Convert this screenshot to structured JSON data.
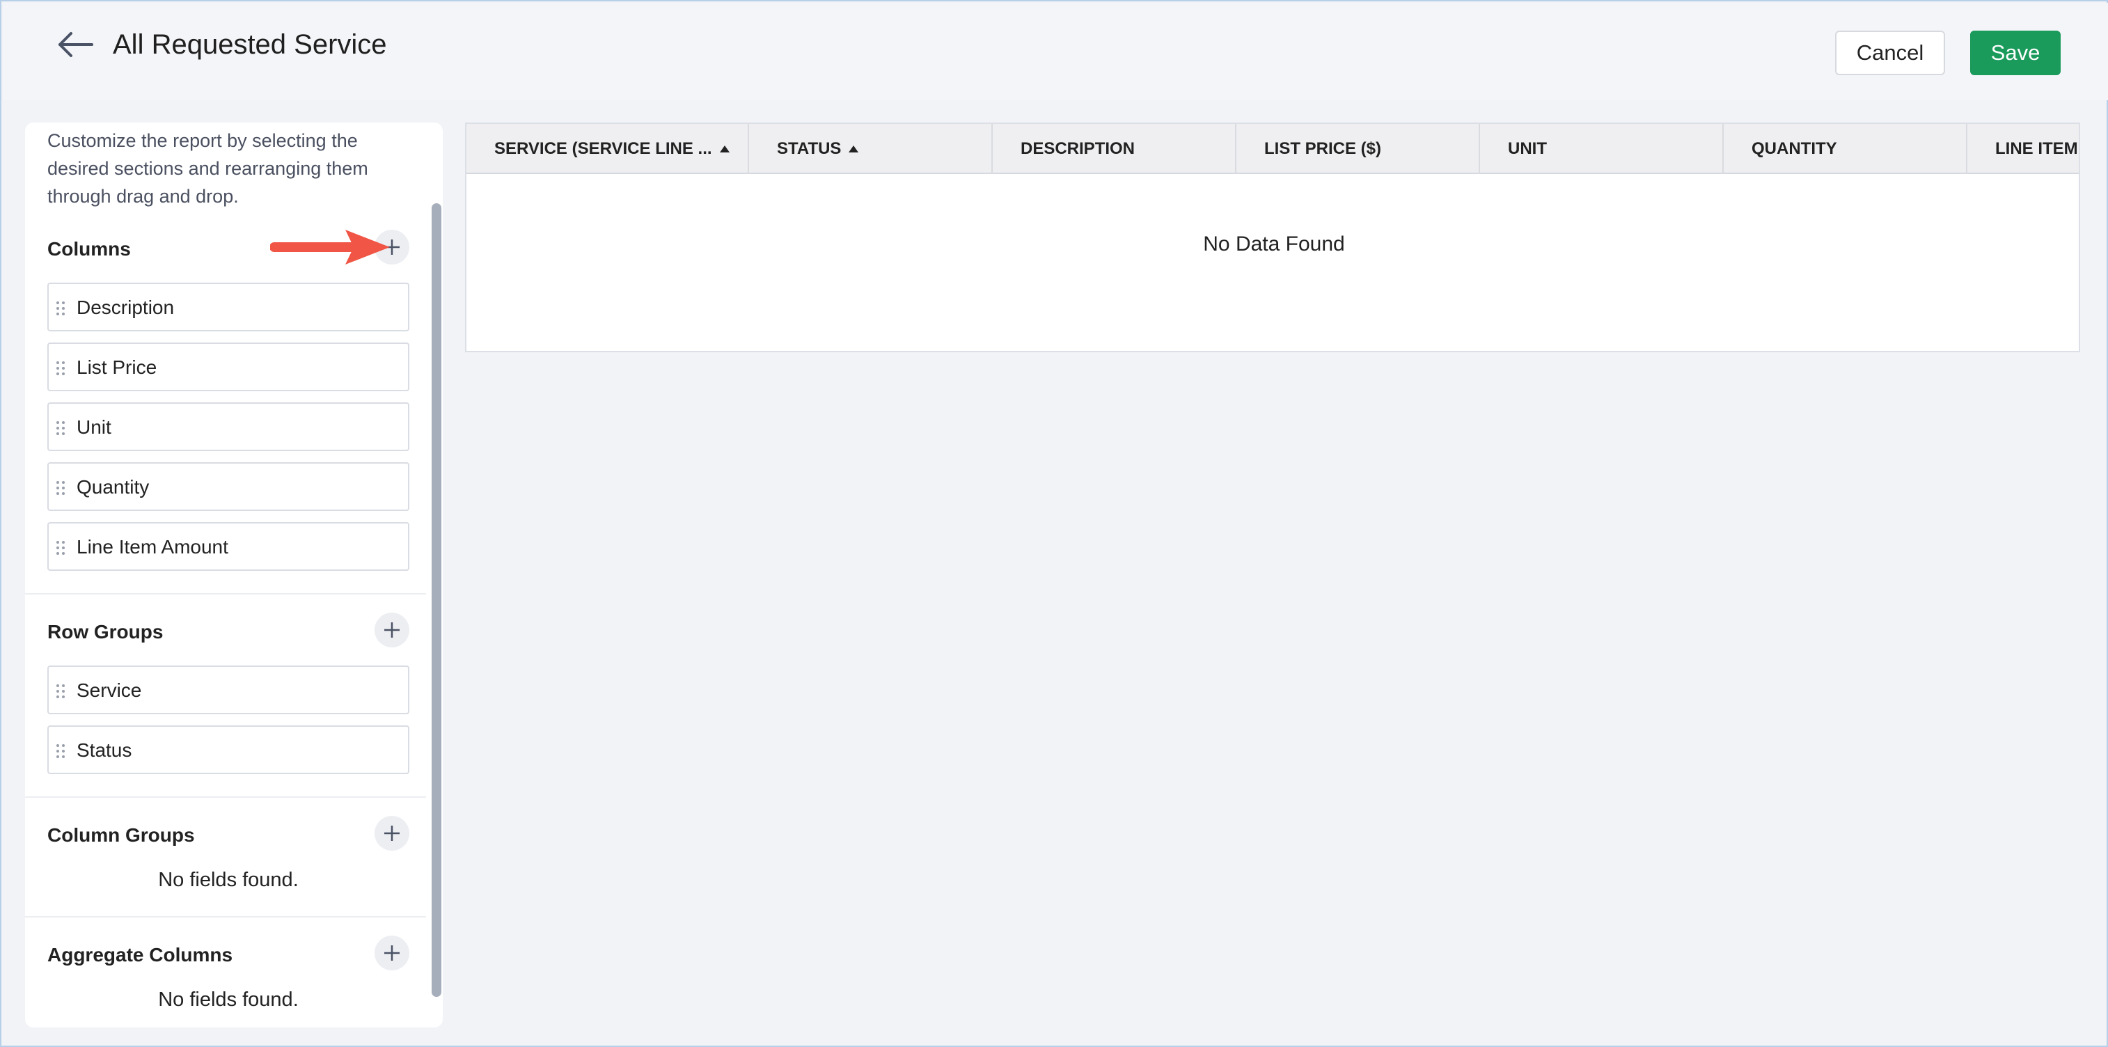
{
  "header": {
    "title": "All Requested Service",
    "cancel_label": "Cancel",
    "save_label": "Save"
  },
  "sidebar": {
    "intro": "Customize the report by selecting the desired sections and rearranging them through drag and drop.",
    "columns": {
      "title": "Columns",
      "items": [
        "Description",
        "List Price",
        "Unit",
        "Quantity",
        "Line Item Amount"
      ]
    },
    "row_groups": {
      "title": "Row Groups",
      "items": [
        "Service",
        "Status"
      ]
    },
    "column_groups": {
      "title": "Column Groups",
      "empty_text": "No fields found."
    },
    "aggregate_columns": {
      "title": "Aggregate Columns",
      "empty_text": "No fields found."
    }
  },
  "table": {
    "headers": [
      "SERVICE (SERVICE LINE ...",
      "STATUS",
      "DESCRIPTION",
      "LIST PRICE ($)",
      "UNIT",
      "QUANTITY",
      "LINE ITEM A"
    ],
    "empty_text": "No Data Found"
  },
  "colors": {
    "save_green": "#1a9a5b",
    "annotation_arrow": "#f05545",
    "icon_gray": "#4a5265"
  },
  "icons": {
    "back": "arrow-left-icon",
    "add": "plus-icon",
    "drag": "drag-handle-icon",
    "sort": "sort-ascending-icon",
    "annotation": "red-arrow-annotation"
  }
}
